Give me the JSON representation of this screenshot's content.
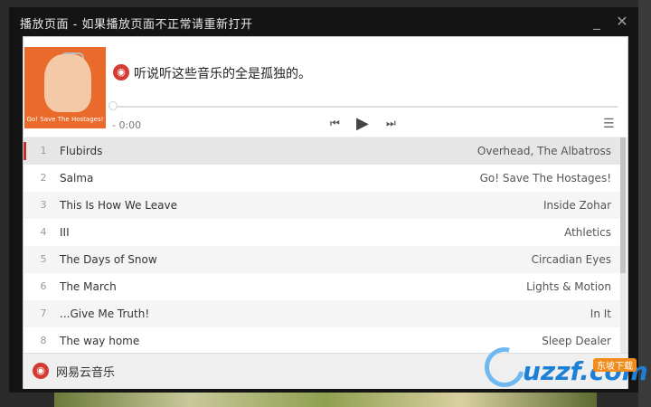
{
  "window": {
    "title": "播放页面 - 如果播放页面不正常请重新打开",
    "min_glyph": "_",
    "close_glyph": "✕"
  },
  "player": {
    "cover_text": "Go! Save The Hostages!",
    "logo_glyph": "◉",
    "now_playing_title": "听说听这些音乐的全是孤独的。",
    "time": "- 0:00",
    "progress": 0,
    "icons": {
      "prev": "prev-icon",
      "play": "play-icon",
      "next": "next-icon",
      "playlist": "playlist-icon"
    },
    "glyphs": {
      "prev": "⏮",
      "play": "▶",
      "next": "⏭",
      "playlist": "☰"
    }
  },
  "tracks": [
    {
      "num": "1",
      "title": "Flubirds",
      "album": "Overhead, The Albatross"
    },
    {
      "num": "2",
      "title": "Salma",
      "album": "Go! Save The Hostages!"
    },
    {
      "num": "3",
      "title": "This Is How We Leave",
      "album": "Inside Zohar"
    },
    {
      "num": "4",
      "title": "III",
      "album": "Athletics"
    },
    {
      "num": "5",
      "title": "The Days of Snow",
      "album": "Circadian Eyes"
    },
    {
      "num": "6",
      "title": "The March",
      "album": "Lights & Motion"
    },
    {
      "num": "7",
      "title": "...Give Me Truth!",
      "album": "In It"
    },
    {
      "num": "8",
      "title": "The way home",
      "album": "Sleep Dealer"
    }
  ],
  "footer": {
    "logo_glyph": "◉",
    "label": "网易云音乐"
  },
  "watermark": {
    "text": "uzzf.com",
    "badge": "东坡下载"
  },
  "colors": {
    "accent": "#c62f2f",
    "brand": "#d43b33"
  }
}
